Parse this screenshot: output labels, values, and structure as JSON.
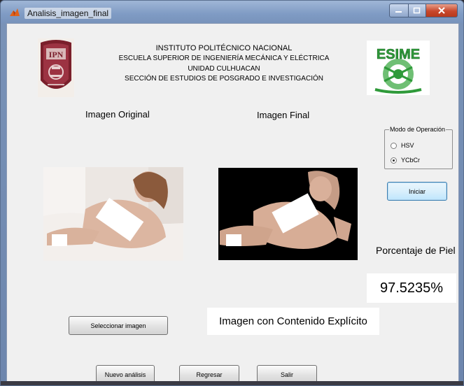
{
  "window": {
    "title": "Analisis_imagen_final",
    "controls": [
      "minimize-icon",
      "maximize-icon",
      "close-icon"
    ]
  },
  "header": {
    "line1": "INSTITUTO POLITÉCNICO NACIONAL",
    "line2": "ESCUELA SUPERIOR DE INGENIERÍA MECÁNICA Y ELÉCTRICA",
    "line3": "UNIDAD CULHUACAN",
    "line4": "SECCIÓN DE ESTUDIOS DE POSGRADO E INVESTIGACIÓN",
    "logo_left_text": "IPN",
    "logo_right_text": "ESIME"
  },
  "images": {
    "original_label": "Imagen Original",
    "final_label": "Imagen Final"
  },
  "modo": {
    "legend": "Modo de Operación",
    "options": [
      {
        "label": "HSV",
        "selected": false
      },
      {
        "label": "YCbCr",
        "selected": true
      }
    ]
  },
  "buttons": {
    "iniciar": "Iniciar",
    "seleccionar": "Seleccionar imagen",
    "nuevo": "Nuevo análisis",
    "regresar": "Regresar",
    "salir": "Salir"
  },
  "results": {
    "porcentaje_label": "Porcentaje de Piel",
    "porcentaje_value": "97.5235%",
    "clasificacion": "Imagen con Contenido Explícito"
  },
  "colors": {
    "ipn_maroon": "#7a1f2b",
    "esime_green": "#2f9a3a",
    "iniciar_blue": "#3c7fb1"
  }
}
